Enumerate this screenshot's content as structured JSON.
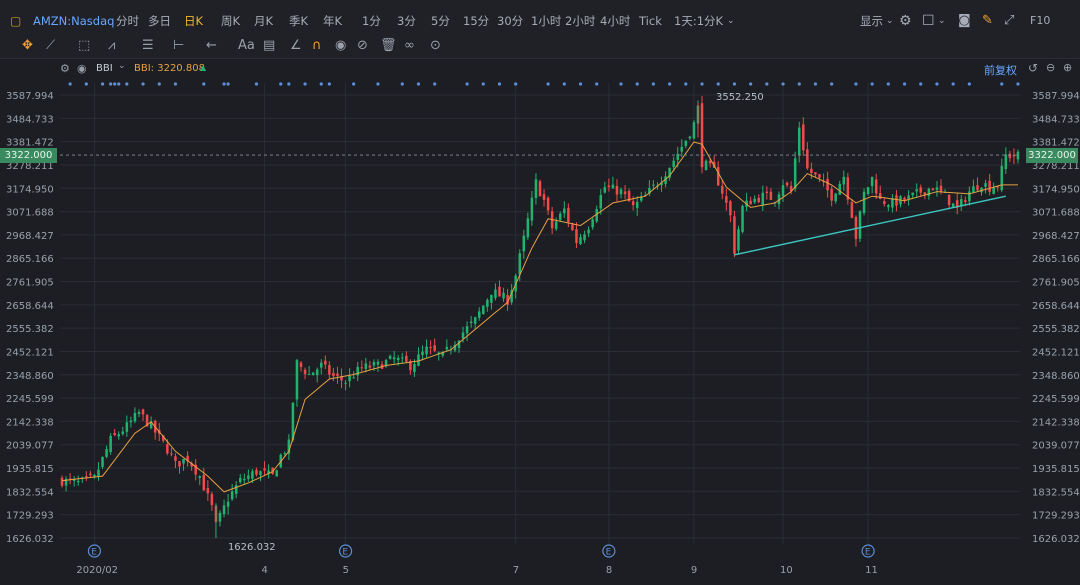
{
  "toolbar": {
    "symbol": "AMZN:Nasdaq",
    "periods": [
      "分时",
      "多日",
      "日K",
      "周K",
      "月K",
      "季K",
      "年K",
      "1分",
      "3分",
      "5分",
      "15分",
      "30分",
      "1小时",
      "2小时",
      "4小时",
      "Tick",
      "1天:1分K"
    ],
    "active_period": "日K",
    "display_label": "显示",
    "f10_label": "F10"
  },
  "indicator": {
    "name": "BBI",
    "value_label": "BBI: 3220.808",
    "adjust_label": "前复权"
  },
  "colors": {
    "up": "#23b26d",
    "down": "#f04a4a",
    "bbi": "#e8a042",
    "trend": "#3cc6c0",
    "bg": "#1c1e24",
    "grid": "#2a2d34"
  },
  "chart_data": {
    "type": "candlestick",
    "y_ticks": [
      "3587.994",
      "3484.733",
      "3381.472",
      "3278.211",
      "3174.950",
      "3071.688",
      "2968.427",
      "2865.166",
      "2761.905",
      "2658.644",
      "2555.382",
      "2452.121",
      "2348.860",
      "2245.599",
      "2142.338",
      "2039.077",
      "1935.815",
      "1832.554",
      "1729.293",
      "1626.032"
    ],
    "ylim": [
      1626.032,
      3587.994
    ],
    "x_labels": [
      {
        "label": "2020/02",
        "idx": 8
      },
      {
        "label": "4",
        "idx": 50
      },
      {
        "label": "5",
        "idx": 70
      },
      {
        "label": "7",
        "idx": 112
      },
      {
        "label": "8",
        "idx": 135
      },
      {
        "label": "9",
        "idx": 156
      },
      {
        "label": "10",
        "idx": 178
      },
      {
        "label": "11",
        "idx": 199
      }
    ],
    "n_bars": 237,
    "current_price": "3322.000",
    "max_label": "3552.250",
    "max_idx": 157,
    "min_label": "1626.032",
    "min_idx": 38,
    "closes_anchor": [
      [
        0,
        1880
      ],
      [
        4,
        1870
      ],
      [
        8,
        1890
      ],
      [
        12,
        2060
      ],
      [
        16,
        2120
      ],
      [
        19,
        2180
      ],
      [
        22,
        2120
      ],
      [
        26,
        2020
      ],
      [
        28,
        1950
      ],
      [
        31,
        1980
      ],
      [
        34,
        1900
      ],
      [
        37,
        1760
      ],
      [
        38,
        1680
      ],
      [
        41,
        1800
      ],
      [
        44,
        1880
      ],
      [
        48,
        1920
      ],
      [
        52,
        1900
      ],
      [
        54,
        1990
      ],
      [
        56,
        2040
      ],
      [
        57,
        2230
      ],
      [
        58,
        2400
      ],
      [
        61,
        2350
      ],
      [
        64,
        2390
      ],
      [
        67,
        2340
      ],
      [
        70,
        2320
      ],
      [
        74,
        2380
      ],
      [
        78,
        2390
      ],
      [
        82,
        2420
      ],
      [
        86,
        2390
      ],
      [
        90,
        2460
      ],
      [
        94,
        2430
      ],
      [
        98,
        2520
      ],
      [
        102,
        2590
      ],
      [
        106,
        2720
      ],
      [
        110,
        2680
      ],
      [
        112,
        2790
      ],
      [
        114,
        2950
      ],
      [
        117,
        3200
      ],
      [
        119,
        3120
      ],
      [
        121,
        3000
      ],
      [
        124,
        3080
      ],
      [
        127,
        2940
      ],
      [
        130,
        3010
      ],
      [
        132,
        3100
      ],
      [
        134,
        3180
      ],
      [
        138,
        3160
      ],
      [
        141,
        3090
      ],
      [
        144,
        3140
      ],
      [
        148,
        3220
      ],
      [
        151,
        3300
      ],
      [
        154,
        3390
      ],
      [
        156,
        3460
      ],
      [
        157,
        3530
      ],
      [
        158,
        3290
      ],
      [
        161,
        3250
      ],
      [
        163,
        3160
      ],
      [
        165,
        3050
      ],
      [
        166,
        2900
      ],
      [
        168,
        3090
      ],
      [
        170,
        3120
      ],
      [
        173,
        3140
      ],
      [
        176,
        3130
      ],
      [
        178,
        3200
      ],
      [
        180,
        3160
      ],
      [
        182,
        3450
      ],
      [
        184,
        3260
      ],
      [
        187,
        3210
      ],
      [
        190,
        3140
      ],
      [
        193,
        3230
      ],
      [
        195,
        3060
      ],
      [
        196,
        2960
      ],
      [
        198,
        3150
      ],
      [
        200,
        3220
      ],
      [
        202,
        3120
      ],
      [
        205,
        3110
      ],
      [
        209,
        3130
      ],
      [
        212,
        3160
      ],
      [
        215,
        3180
      ],
      [
        218,
        3140
      ],
      [
        221,
        3080
      ],
      [
        224,
        3160
      ],
      [
        227,
        3200
      ],
      [
        229,
        3180
      ],
      [
        231,
        3190
      ],
      [
        233,
        3320
      ]
    ],
    "bbi_anchor": [
      [
        0,
        1880
      ],
      [
        10,
        1900
      ],
      [
        18,
        2090
      ],
      [
        22,
        2140
      ],
      [
        28,
        2010
      ],
      [
        36,
        1900
      ],
      [
        40,
        1830
      ],
      [
        46,
        1870
      ],
      [
        52,
        1920
      ],
      [
        56,
        2010
      ],
      [
        60,
        2240
      ],
      [
        66,
        2330
      ],
      [
        72,
        2350
      ],
      [
        80,
        2390
      ],
      [
        88,
        2410
      ],
      [
        96,
        2460
      ],
      [
        104,
        2580
      ],
      [
        110,
        2670
      ],
      [
        116,
        2910
      ],
      [
        120,
        3040
      ],
      [
        128,
        3010
      ],
      [
        136,
        3110
      ],
      [
        144,
        3140
      ],
      [
        150,
        3230
      ],
      [
        156,
        3380
      ],
      [
        158,
        3370
      ],
      [
        164,
        3180
      ],
      [
        170,
        3090
      ],
      [
        176,
        3110
      ],
      [
        180,
        3160
      ],
      [
        184,
        3240
      ],
      [
        190,
        3190
      ],
      [
        196,
        3110
      ],
      [
        200,
        3140
      ],
      [
        208,
        3120
      ],
      [
        216,
        3160
      ],
      [
        224,
        3150
      ],
      [
        232,
        3190
      ]
    ],
    "trendline": [
      [
        166,
        2880
      ],
      [
        233,
        3140
      ]
    ],
    "event_marker_label": "E",
    "event_marker_idx": [
      8,
      70,
      135,
      199
    ],
    "top_dot_idx": [
      2,
      6,
      10,
      12,
      13,
      14,
      16,
      20,
      24,
      28,
      35,
      40,
      41,
      48,
      54,
      56,
      60,
      64,
      66,
      72,
      78,
      84,
      88,
      92,
      100,
      104,
      108,
      112,
      120,
      124,
      128,
      132,
      138,
      142,
      146,
      150,
      154,
      158,
      162,
      166,
      170,
      174,
      178,
      182,
      186,
      190,
      196,
      200,
      204,
      208,
      212,
      216,
      220,
      224,
      232,
      236
    ]
  }
}
